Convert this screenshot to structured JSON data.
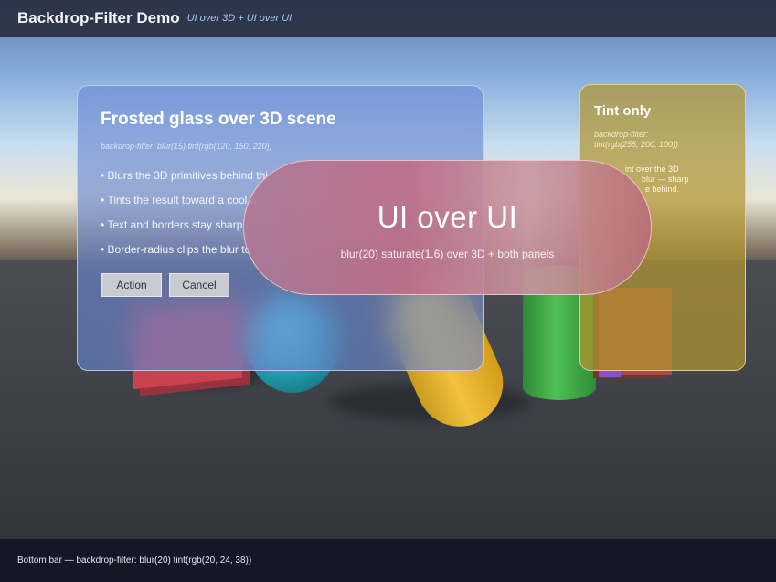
{
  "header": {
    "title": "Backdrop-Filter Demo",
    "subtitle": "UI over 3D + UI over UI"
  },
  "frosted_panel": {
    "title": "Frosted glass over 3D scene",
    "filter_code": "backdrop-filter: blur(15) tint(rgb(120, 150, 220))",
    "bullets": [
      "• Blurs the 3D primitives behind thi",
      "• Tints the result toward a cool b",
      "• Text and borders stay sharp (",
      "• Border-radius clips the blur to"
    ],
    "action_label": "Action",
    "cancel_label": "Cancel"
  },
  "tint_panel": {
    "title": "Tint only",
    "filter_code_line1": "backdrop-filter:",
    "filter_code_line2": "tint(rgb(255, 200, 100))",
    "desc_line1": "int over the 3D",
    "desc_line2": "blur — sharp",
    "desc_line3": "e behind."
  },
  "pill": {
    "heading": "UI over UI",
    "caption": "blur(20) saturate(1.6) over 3D + both panels"
  },
  "bottom_bar": {
    "text": "Bottom bar — backdrop-filter: blur(20) tint(rgb(20, 24, 38))"
  },
  "colors": {
    "frosted_tint": "#7896dc",
    "tint_only": "#ffc864",
    "bottom_bar": "#141826"
  }
}
